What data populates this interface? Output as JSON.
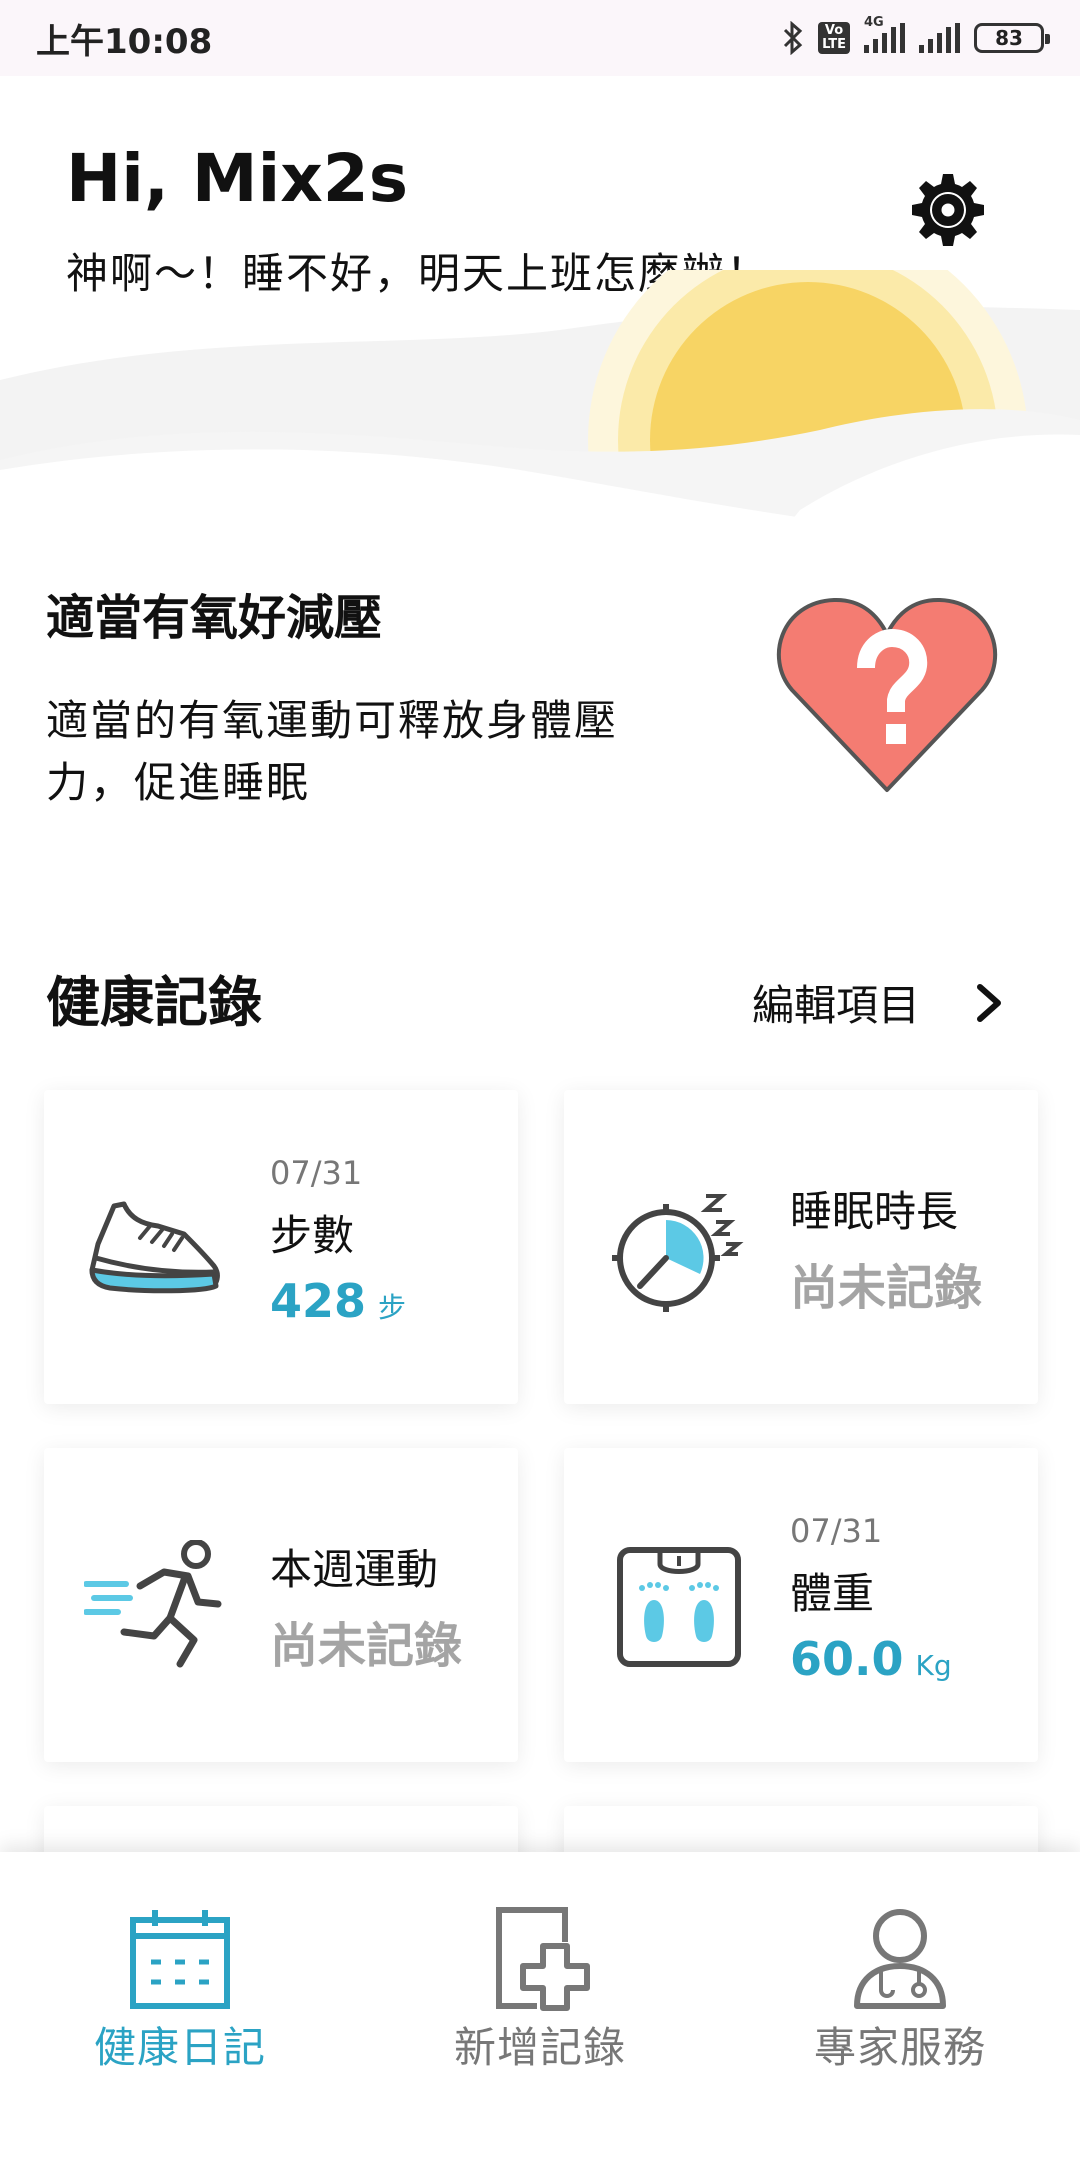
{
  "status_bar": {
    "time": "上午10:08",
    "network": "4G",
    "battery": "83",
    "volte_line1": "Vo",
    "volte_line2": "LTE"
  },
  "header": {
    "greeting": "Hi, Mix2s",
    "subtitle": "神啊～！睡不好，明天上班怎麼辦！"
  },
  "tip": {
    "title": "適當有氧好減壓",
    "body": "適當的有氧運動可釋放身體壓力，促進睡眠"
  },
  "section": {
    "title": "健康記錄",
    "edit_label": "編輯項目"
  },
  "cards": [
    {
      "date": "07/31",
      "label": "步數",
      "value": "428",
      "unit": "步",
      "icon": "sneaker-icon"
    },
    {
      "label": "睡眠時長",
      "status": "尚未記錄",
      "icon": "sleep-timer-icon"
    },
    {
      "label": "本週運動",
      "status": "尚未記錄",
      "icon": "running-icon"
    },
    {
      "date": "07/31",
      "label": "體重",
      "value": "60.0",
      "unit": "Kg",
      "icon": "scale-icon"
    }
  ],
  "nav": [
    {
      "label": "健康日記",
      "icon": "calendar-icon",
      "active": true
    },
    {
      "label": "新增記錄",
      "icon": "add-document-icon",
      "active": false
    },
    {
      "label": "專家服務",
      "icon": "doctor-icon",
      "active": false
    }
  ],
  "colors": {
    "accent": "#2ba3c4",
    "heart": "#f47c72",
    "sun": "#f7d464",
    "muted": "#a4a4a4"
  }
}
